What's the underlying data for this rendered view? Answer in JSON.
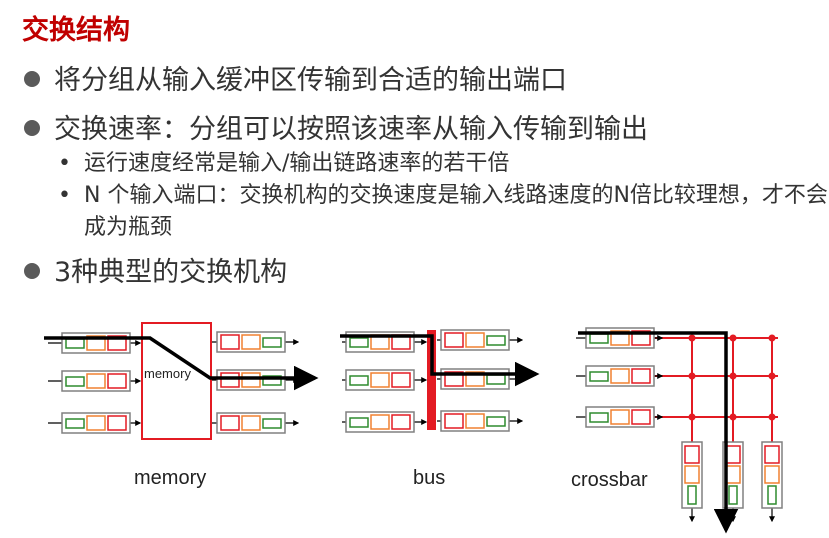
{
  "title": "交换结构",
  "bullets": [
    "将分组从输入缓冲区传输到合适的输出端口",
    "交换速率：分组可以按照该速率从输入传输到输出"
  ],
  "sub_bullets": [
    "运行速度经常是输入/输出链路速率的若干倍",
    "N 个输入端口：交换机构的交换速度是输入线路速度的N倍比较理想，才不会成为瓶颈"
  ],
  "bullet3": "3种典型的交换机构",
  "diagrams": {
    "memory_inner_label": "memory",
    "captions": [
      "memory",
      "bus",
      "crossbar"
    ]
  },
  "colors": {
    "title": "#c00000",
    "fabric_red": "#e31b23",
    "buffer_green": "#2e8b2e",
    "buffer_orange": "#f08030",
    "buffer_red": "#e31b23",
    "port_border": "#808080"
  }
}
